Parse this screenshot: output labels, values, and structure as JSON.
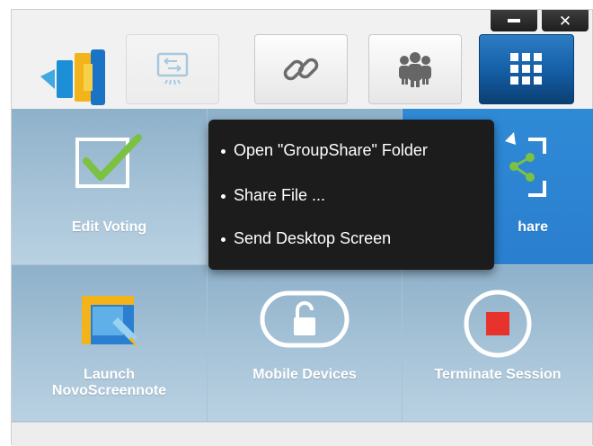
{
  "window": {
    "minimize_icon": "minimize-icon",
    "close_icon": "close-icon",
    "close_glyph": "✕"
  },
  "toolbar": {
    "logo_icon": "novo-logo-icon",
    "buttons": [
      {
        "name": "screen-mirror-icon",
        "state": "disabled"
      },
      {
        "name": "link-icon",
        "state": "normal"
      },
      {
        "name": "group-icon",
        "state": "normal"
      },
      {
        "name": "grid-menu-icon",
        "state": "active"
      }
    ],
    "accent_color": "#1560a8"
  },
  "tiles": [
    {
      "label": "Edit Voting",
      "icon": "voting-checkmark-icon"
    },
    {
      "label": "",
      "icon": "hidden-by-popup"
    },
    {
      "label": "hare",
      "icon": "share-icon"
    },
    {
      "label_line1": "Launch",
      "label_line2": "NovoScreennote",
      "icon": "screennote-icon"
    },
    {
      "label": "Mobile Devices",
      "icon": "unlock-icon"
    },
    {
      "label": "Terminate Session",
      "icon": "stop-record-icon"
    }
  ],
  "popup": {
    "items": [
      "Open \"GroupShare\" Folder",
      "Share File ...",
      "Send Desktop Screen"
    ]
  },
  "colors": {
    "tile_bg": "#a9c5d9",
    "tile_active": "#2a7fce",
    "check_green": "#7bc142",
    "stop_red": "#e8332c",
    "popup_bg": "#1c1c1c"
  }
}
